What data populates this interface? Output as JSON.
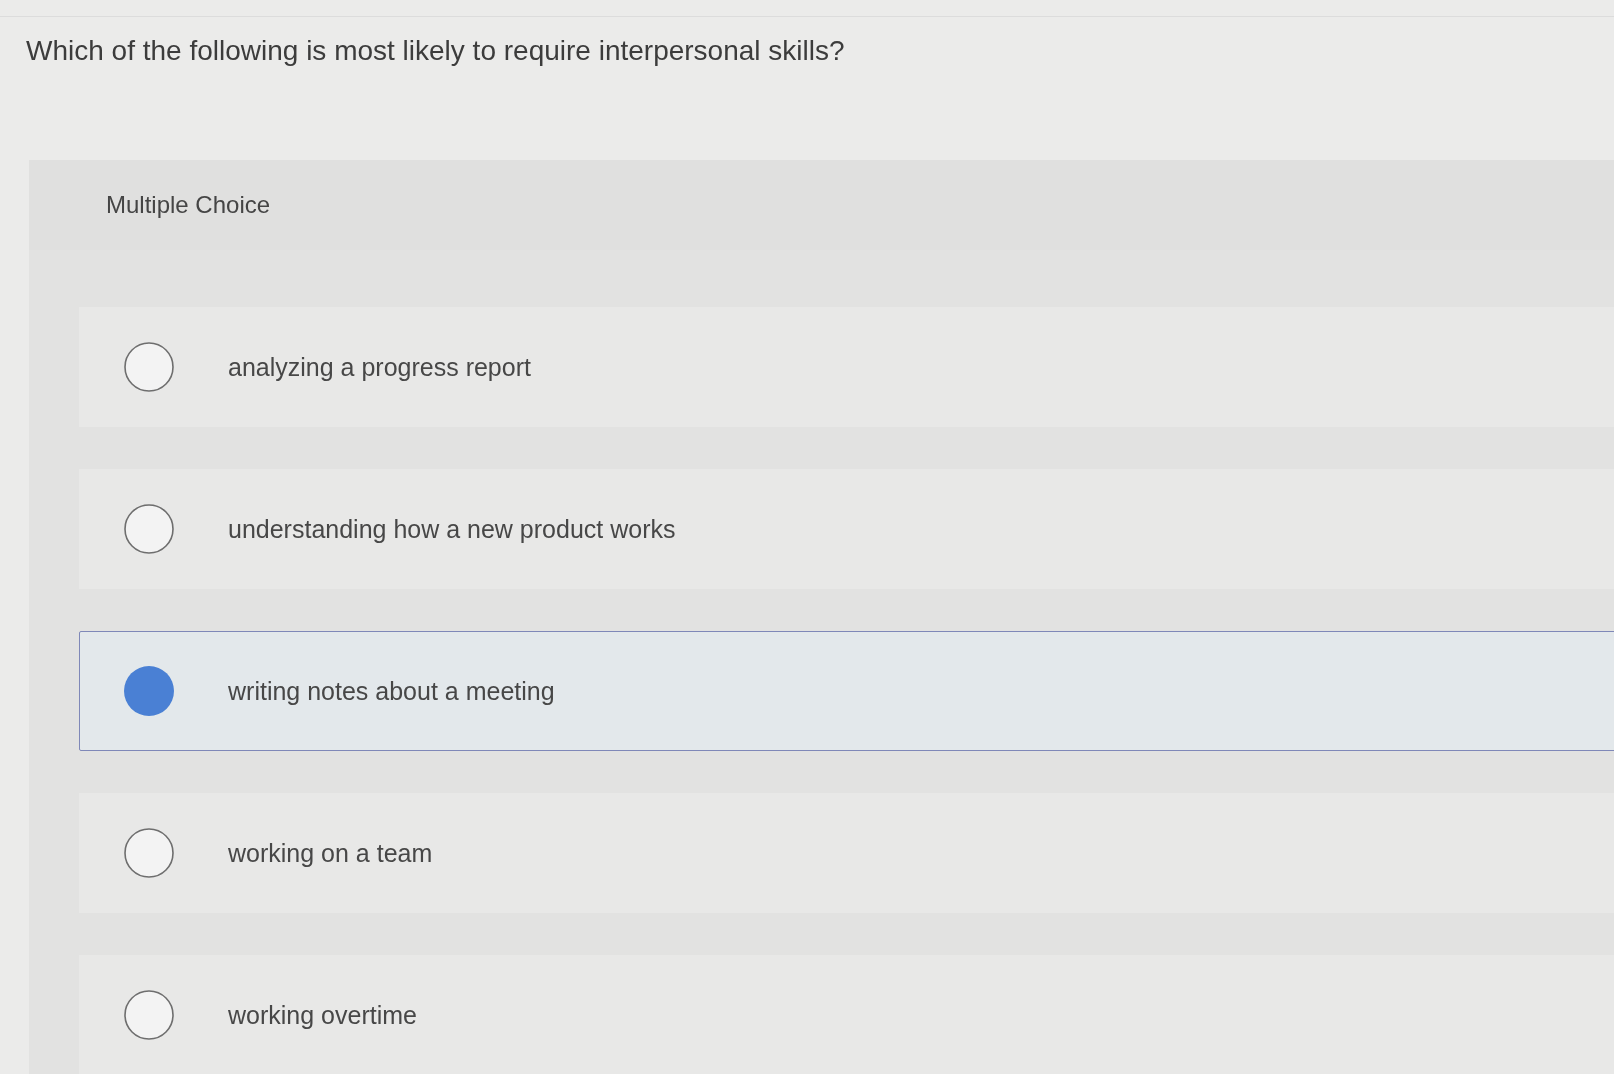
{
  "question": "Which of the following is most likely to require interpersonal skills?",
  "answer_panel": {
    "heading": "Multiple Choice",
    "options": [
      {
        "label": "analyzing a progress report",
        "selected": false
      },
      {
        "label": "understanding how a new product works",
        "selected": false
      },
      {
        "label": "writing notes about a meeting",
        "selected": true
      },
      {
        "label": "working on a team",
        "selected": false
      },
      {
        "label": "working overtime",
        "selected": false
      }
    ]
  }
}
